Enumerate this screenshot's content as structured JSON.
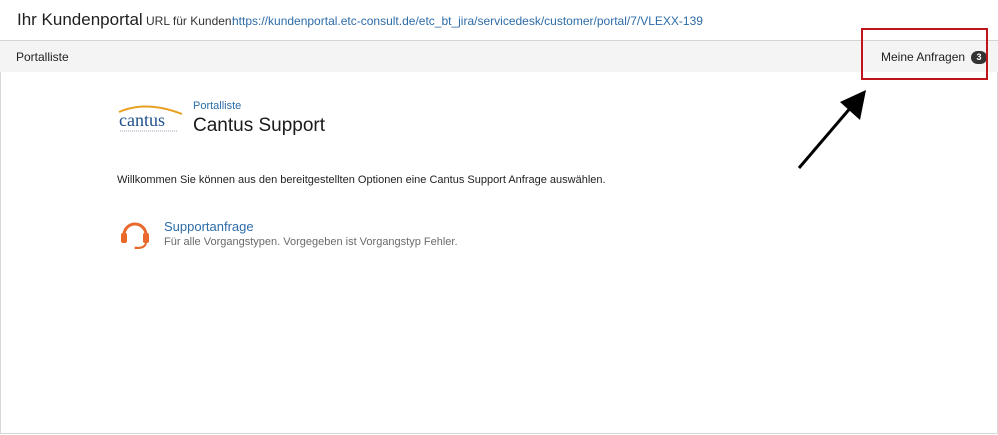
{
  "header": {
    "title": "Ihr Kundenportal",
    "url_label": "URL für Kunden:",
    "url": "https://kundenportal.etc-consult.de/etc_bt_jira/servicedesk/customer/portal/7/VLEXX-139"
  },
  "nav": {
    "portal_list": "Portalliste",
    "my_requests": "Meine Anfragen",
    "my_requests_count": "3"
  },
  "portal": {
    "logo_text": "cantus",
    "breadcrumb": "Portalliste",
    "title": "Cantus Support",
    "welcome": "Willkommen Sie können aus den bereitgestellten Optionen eine Cantus Support Anfrage auswählen."
  },
  "request_types": [
    {
      "icon": "headset-icon",
      "title": "Supportanfrage",
      "description": "Für alle Vorgangstypen. Vorgegeben ist Vorgangstyp Fehler."
    }
  ],
  "colors": {
    "link": "#2d6ca8",
    "highlight_box": "#c0141c",
    "headset_icon": "#e8692b",
    "logo_swoosh": "#e8a020",
    "logo_text": "#1e4f8c"
  }
}
